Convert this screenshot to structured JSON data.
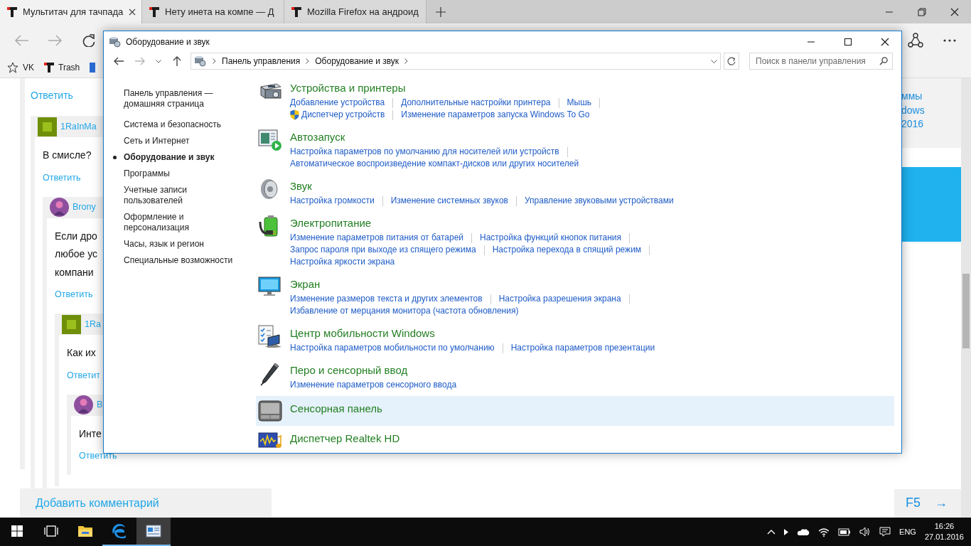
{
  "browser": {
    "tabs": [
      {
        "title": "Мультитач для тачпада",
        "selected": true
      },
      {
        "title": "Нету инета на компе — Д",
        "selected": false
      },
      {
        "title": "Mozilla Firefox на андроид",
        "selected": false
      }
    ],
    "nav_buttons": [
      {
        "kind": "back",
        "disabled": true
      },
      {
        "kind": "forward",
        "disabled": true
      },
      {
        "kind": "refresh",
        "disabled": false
      }
    ],
    "favorites": [
      {
        "label": "VK",
        "kind": "star"
      },
      {
        "label": "Trash",
        "kind": "site"
      }
    ],
    "top_reply": "Ответить",
    "comments": [
      {
        "author": "1RaInMa",
        "avatar": {
          "kind": "square"
        },
        "lines": [
          "В смисле?"
        ],
        "reply": "Ответить",
        "children": [
          {
            "author": "Brony",
            "avatar": {
              "kind": "round"
            },
            "lines": [
              "Если дро",
              "любое ус",
              "компани"
            ],
            "reply": "Ответить",
            "children": [
              {
                "author": "1Ra",
                "avatar": {
                  "kind": "square"
                },
                "lines": [
                  "Как их"
                ],
                "reply": "Ответит",
                "children": [
                  {
                    "author": "B",
                    "avatar": {
                      "kind": "round"
                    },
                    "lines": [
                      "Инте"
                    ],
                    "reply": "Ответить"
                  }
                ]
              }
            ]
          }
        ]
      }
    ],
    "side_lines": [
      "ммы",
      "dows",
      "2016"
    ],
    "add_comment": "Добавить комментарий",
    "next_page": {
      "key": "F5",
      "arrow": "→"
    }
  },
  "window": {
    "title": "Оборудование и звук",
    "nav_buttons": [
      {
        "kind": "back",
        "disabled": false
      },
      {
        "kind": "forward",
        "disabled": true
      }
    ],
    "breadcrumbs": [
      "Панель управления",
      "Оборудование и звук"
    ],
    "search": {
      "placeholder": "Поиск в панели управления"
    },
    "sidebar": [
      {
        "label": "Панель управления — домашняя страница",
        "selected": false
      },
      {
        "label": "Система и безопасность",
        "selected": false
      },
      {
        "label": "Сеть и Интернет",
        "selected": false
      },
      {
        "label": "Оборудование и звук",
        "selected": true
      },
      {
        "label": "Программы",
        "selected": false
      },
      {
        "label": "Учетные записи пользователей",
        "selected": false
      },
      {
        "label": "Оформление и персонализация",
        "selected": false
      },
      {
        "label": "Часы, язык и регион",
        "selected": false
      },
      {
        "label": "Специальные возможности",
        "selected": false
      }
    ],
    "categories": [
      {
        "kind": "printer",
        "title": "Устройства и принтеры",
        "highlighted": false,
        "link_rows": [
          [
            {
              "label": "Добавление устройства",
              "shield": false
            },
            {
              "label": "Дополнительные настройки принтера",
              "shield": false
            },
            {
              "label": "Мышь",
              "shield": false
            }
          ],
          [
            {
              "label": "Диспетчер устройств",
              "shield": true
            },
            {
              "label": "Изменение параметров запуска Windows To Go",
              "shield": false
            }
          ]
        ]
      },
      {
        "kind": "autoplay",
        "title": "Автозапуск",
        "highlighted": false,
        "link_rows": [
          [
            {
              "label": "Настройка параметров по умолчанию для носителей или устройств",
              "shield": false
            }
          ],
          [
            {
              "label": "Автоматическое воспроизведение компакт-дисков или других носителей",
              "shield": false
            }
          ]
        ]
      },
      {
        "kind": "sound",
        "title": "Звук",
        "highlighted": false,
        "link_rows": [
          [
            {
              "label": "Настройка громкости",
              "shield": false
            },
            {
              "label": "Изменение системных звуков",
              "shield": false
            },
            {
              "label": "Управление звуковыми устройствами",
              "shield": false
            }
          ]
        ]
      },
      {
        "kind": "power",
        "title": "Электропитание",
        "highlighted": false,
        "link_rows": [
          [
            {
              "label": "Изменение параметров питания от батарей",
              "shield": false
            },
            {
              "label": "Настройка функций кнопок питания",
              "shield": false
            }
          ],
          [
            {
              "label": "Запрос пароля при выходе из спящего режима",
              "shield": false
            },
            {
              "label": "Настройка перехода в спящий режим",
              "shield": false
            }
          ],
          [
            {
              "label": "Настройка яркости экрана",
              "shield": false
            }
          ]
        ]
      },
      {
        "kind": "display",
        "title": "Экран",
        "highlighted": false,
        "link_rows": [
          [
            {
              "label": "Изменение размеров текста и других элементов",
              "shield": false
            },
            {
              "label": "Настройка разрешения экрана",
              "shield": false
            }
          ],
          [
            {
              "label": "Избавление от мерцания монитора (частота обновления)",
              "shield": false
            }
          ]
        ]
      },
      {
        "kind": "mobility",
        "title": "Центр мобильности Windows",
        "highlighted": false,
        "link_rows": [
          [
            {
              "label": "Настройка параметров мобильности по умолчанию",
              "shield": false
            },
            {
              "label": "Настройка параметров презентации",
              "shield": false
            }
          ]
        ]
      },
      {
        "kind": "pen",
        "title": "Перо и сенсорный ввод",
        "highlighted": false,
        "link_rows": [
          [
            {
              "label": "Изменение параметров сенсорного ввода",
              "shield": false
            }
          ]
        ]
      },
      {
        "kind": "touchpad",
        "title": "Сенсорная панель",
        "highlighted": true
      },
      {
        "kind": "audio",
        "title": "Диспетчер Realtek HD",
        "highlighted": false
      }
    ]
  },
  "taskbar": {
    "apps": [
      {
        "kind": "start",
        "running": false,
        "selected": false
      },
      {
        "kind": "taskview",
        "running": false,
        "selected": false
      },
      {
        "kind": "explorer",
        "running": false,
        "selected": false
      },
      {
        "kind": "edge",
        "running": true,
        "selected": false
      },
      {
        "kind": "controlpanel",
        "running": true,
        "selected": true
      }
    ],
    "language": "ENG",
    "time": "16:26",
    "date": "27.01.2016"
  }
}
